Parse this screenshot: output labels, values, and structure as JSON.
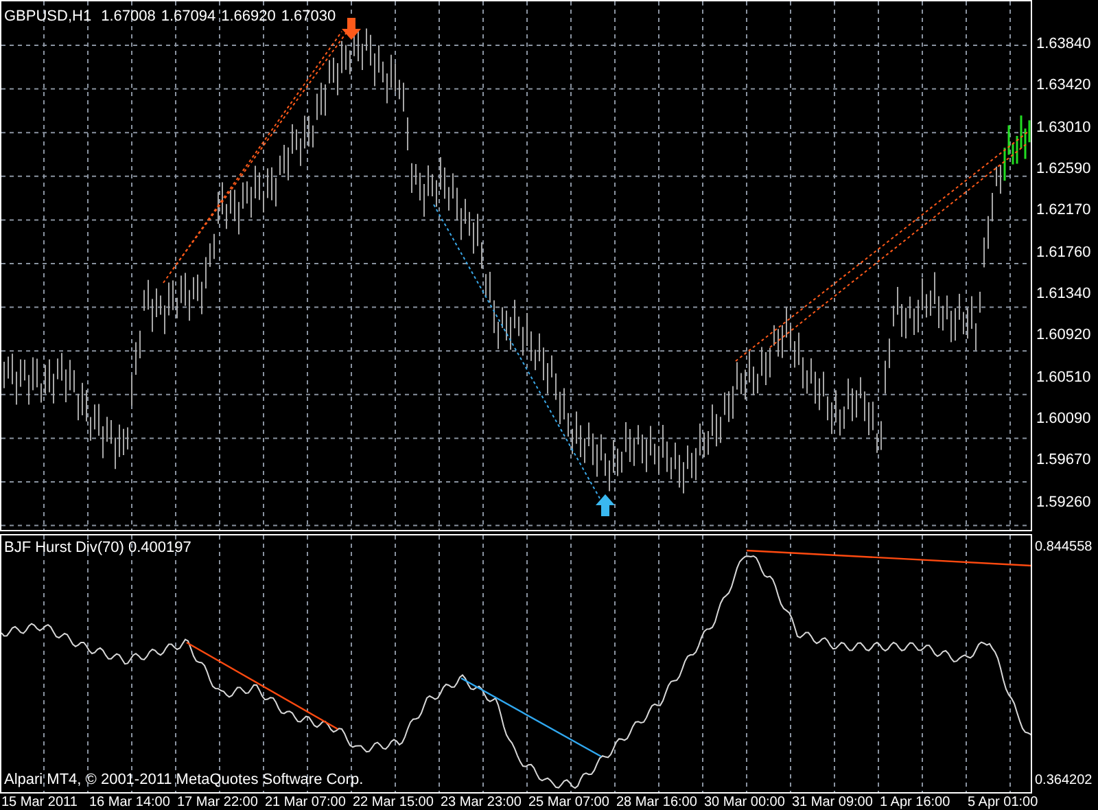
{
  "chart": {
    "symbol": "GBPUSD,H1",
    "quote": [
      "1.67008",
      "1.67094",
      "1.66920",
      "1.67030"
    ]
  },
  "price_axis": [
    "1.63840",
    "1.63420",
    "1.63010",
    "1.62590",
    "1.62170",
    "1.61760",
    "1.61340",
    "1.60920",
    "1.60510",
    "1.60090",
    "1.59670",
    "1.59260"
  ],
  "indicator": {
    "label": "BJF Hurst Div(70) 0.400197",
    "axis": [
      "0.844558",
      "0.364202"
    ]
  },
  "copyright": "Alpari MT4, © 2001-2011 MetaQuotes Software Corp.",
  "time_axis": [
    "15 Mar 2011",
    "16 Mar 14:00",
    "17 Mar 22:00",
    "21 Mar 07:00",
    "22 Mar 15:00",
    "23 Mar 23:00",
    "25 Mar 07:00",
    "28 Mar 16:00",
    "30 Mar 00:00",
    "31 Mar 09:00",
    "1 Apr 16:00",
    "5 Apr 01:00"
  ]
}
